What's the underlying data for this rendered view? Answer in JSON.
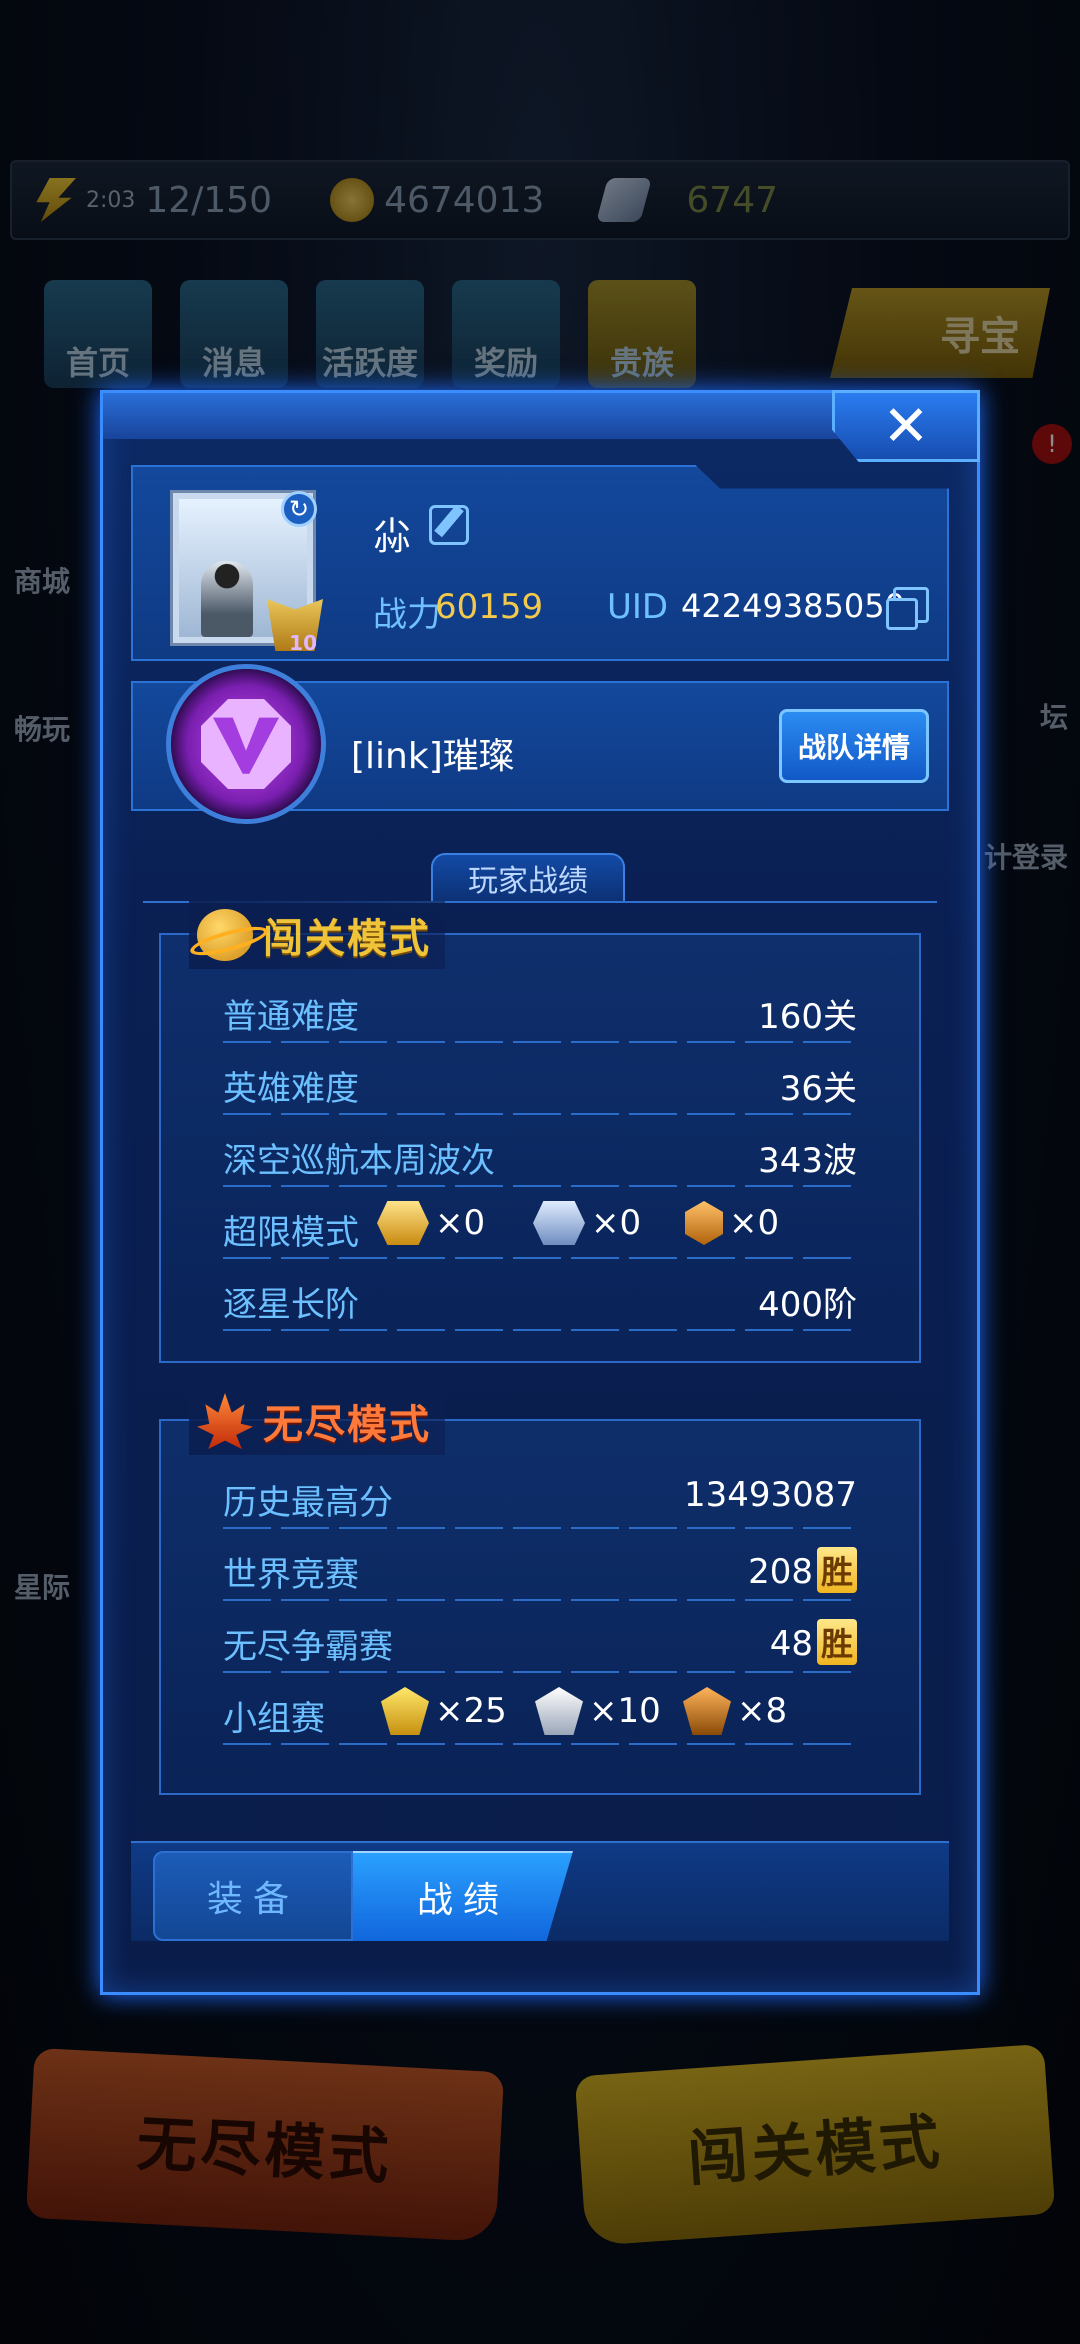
{
  "background": {
    "energy_timer": "2:03",
    "energy": "12/150",
    "coins": "4674013",
    "gems": "6747",
    "nav": [
      "首页",
      "消息",
      "活跃度",
      "奖励",
      "贵族"
    ],
    "treasure": "寻宝",
    "side_left": [
      "商城",
      "畅玩",
      "星际"
    ],
    "side_right": [
      "坛",
      "计登录"
    ],
    "red_dot": "!",
    "mode_buttons": {
      "endless": "无尽模式",
      "stage": "闯关模式"
    }
  },
  "modal": {
    "close_symbol": "✕",
    "profile": {
      "name": "尛",
      "power_label": "战力",
      "power_value": "60159",
      "uid_label": "UID",
      "uid_value": "42249385050",
      "vip_level": "10"
    },
    "team": {
      "name": "[link]璀璨",
      "details_button": "战队详情"
    },
    "section_title": "玩家战绩",
    "stage_mode": {
      "title": "闯关模式",
      "rows": [
        {
          "label": "普通难度",
          "value": "160关"
        },
        {
          "label": "英雄难度",
          "value": "36关"
        },
        {
          "label": "深空巡航本周波次",
          "value": "343波"
        },
        {
          "label": "超限模式",
          "medals": [
            "×0",
            "×0",
            "×0"
          ]
        },
        {
          "label": "逐星长阶",
          "value": "400阶"
        }
      ]
    },
    "endless_mode": {
      "title": "无尽模式",
      "rows": [
        {
          "label": "历史最高分",
          "value": "13493087"
        },
        {
          "label": "世界竞赛",
          "value": "208",
          "badge": "胜"
        },
        {
          "label": "无尽争霸赛",
          "value": "48",
          "badge": "胜"
        },
        {
          "label": "小组赛",
          "medals": [
            "×25",
            "×10",
            "×8"
          ]
        }
      ]
    },
    "tabs": {
      "equipment": "装备",
      "record": "战绩"
    }
  },
  "colors": {
    "accent": "#3a8cff",
    "label": "#6cc0ff",
    "power": "#f2c94c",
    "stage_title": "#f0c438",
    "endless_title": "#ff7a3a"
  }
}
